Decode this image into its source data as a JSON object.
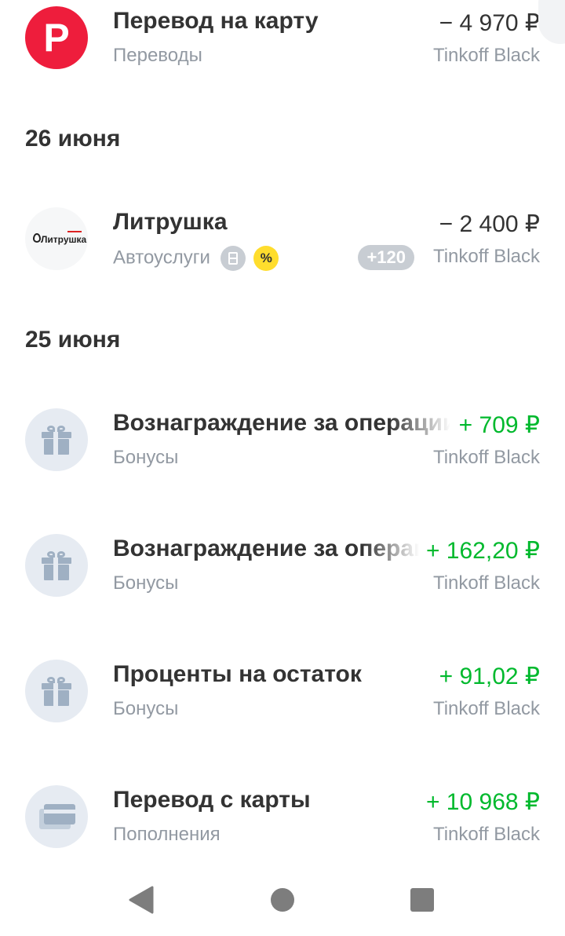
{
  "transactions": [
    {
      "title": "Перевод на карту",
      "category": "Переводы",
      "amount": "− 4 970 ₽",
      "account": "Tinkoff Black",
      "icon": "letter-p-icon",
      "icon_letter": "P"
    },
    {
      "title": "Литрушка",
      "category": "Автоуслуги",
      "amount": "− 2 400 ₽",
      "account": "Tinkoff Black",
      "cashback": "+120",
      "logo_text": "Литрушка"
    },
    {
      "title": "Вознаграждение за операции",
      "category": "Бонусы",
      "amount": "+ 709 ₽",
      "account": "Tinkoff Black",
      "icon": "gift-icon"
    },
    {
      "title": "Вознаграждение за операции",
      "category": "Бонусы",
      "amount": "+ 162,20 ₽",
      "account": "Tinkoff Black",
      "icon": "gift-icon"
    },
    {
      "title": "Проценты на остаток",
      "category": "Бонусы",
      "amount": "+ 91,02 ₽",
      "account": "Tinkoff Black",
      "icon": "gift-icon"
    },
    {
      "title": "Перевод с карты",
      "category": "Пополнения",
      "amount": "+ 10 968 ₽",
      "account": "Tinkoff Black",
      "icon": "card-icon"
    }
  ],
  "dates": [
    "26 июня",
    "25 июня"
  ],
  "colors": {
    "positive": "#00b92d",
    "red_icon": "#ee1d3c",
    "muted": "#9299a2",
    "icon_bg": "#e6ebf2",
    "percent_badge": "#ffdd2d"
  }
}
